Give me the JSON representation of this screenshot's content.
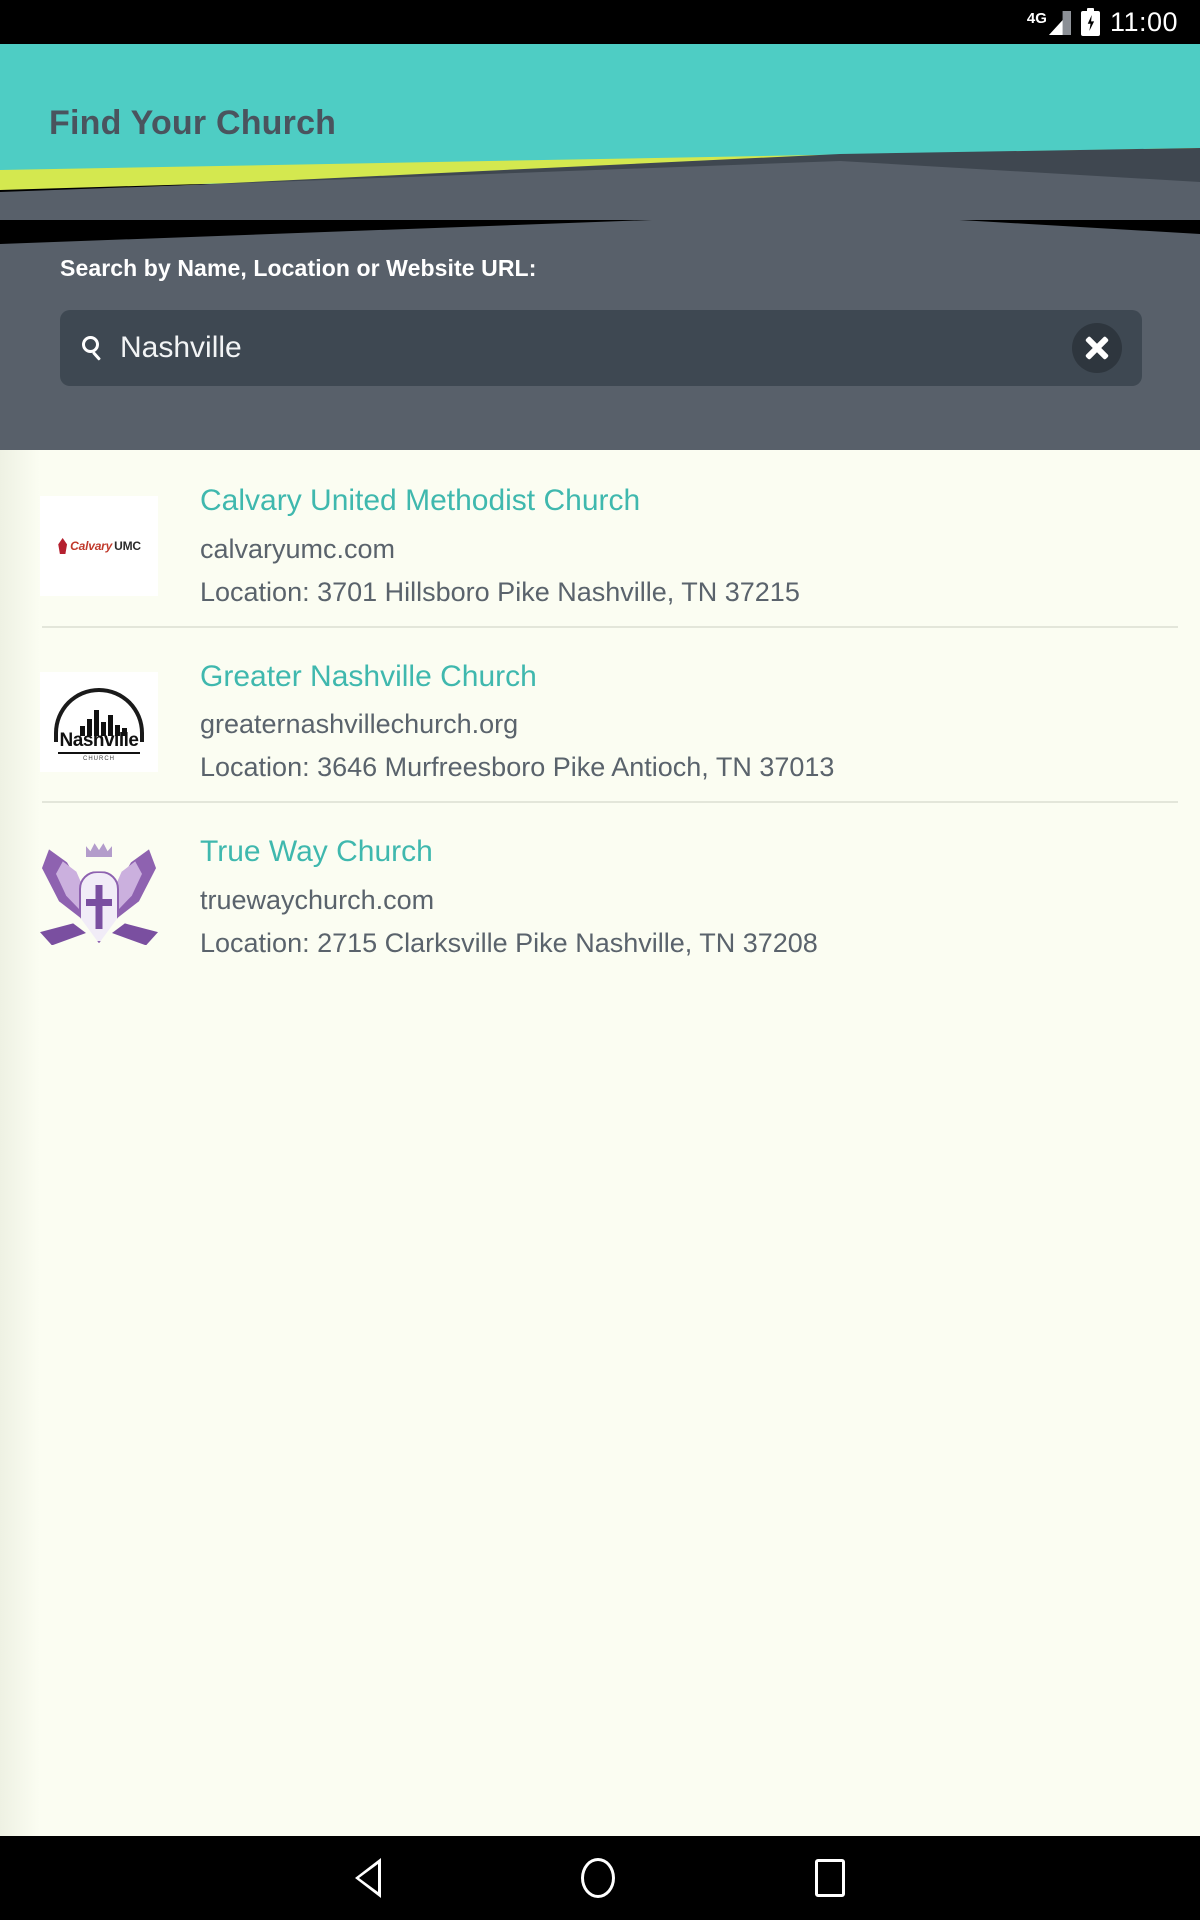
{
  "status_bar": {
    "network_label": "4G",
    "signal_icon": "signal-bars-icon",
    "battery_icon": "battery-charging-icon",
    "time": "11:00"
  },
  "header": {
    "title": "Find Your Church",
    "background_color": "#4ecdc4",
    "accent_color": "#d4e84f",
    "panel_color": "#58606a"
  },
  "search": {
    "label": "Search by Name, Location or Website URL:",
    "value": "Nashville",
    "placeholder": "Search by Name, Location or Website URL",
    "search_icon": "magnifier-icon",
    "clear_icon": "clear-x-icon"
  },
  "results": [
    {
      "name": "Calvary United Methodist Church",
      "url": "calvaryumc.com",
      "location": "Location: 3701 Hillsboro Pike Nashville, TN 37215",
      "logo_name": "calvary-umc-logo",
      "logo_text_1": "Calvary",
      "logo_text_2": "UMC"
    },
    {
      "name": "Greater Nashville Church",
      "url": "greaternashvillechurch.org",
      "location": "Location: 3646 Murfreesboro Pike Antioch, TN 37013",
      "logo_name": "greater-nashville-church-logo",
      "logo_text_1": "Nashville",
      "logo_text_2": "CHURCH"
    },
    {
      "name": "True Way Church",
      "url": "truewaychurch.com",
      "location": "Location: 2715 Clarksville Pike Nashville, TN 37208",
      "logo_name": "true-way-church-logo",
      "logo_text_1": "",
      "logo_text_2": ""
    }
  ],
  "colors": {
    "link": "#3fb8ae",
    "body_text": "#5a636c",
    "content_background": "#fbfdf2"
  },
  "nav_bar": {
    "back_icon": "back-triangle-icon",
    "home_icon": "home-circle-icon",
    "recents_icon": "recents-square-icon"
  }
}
